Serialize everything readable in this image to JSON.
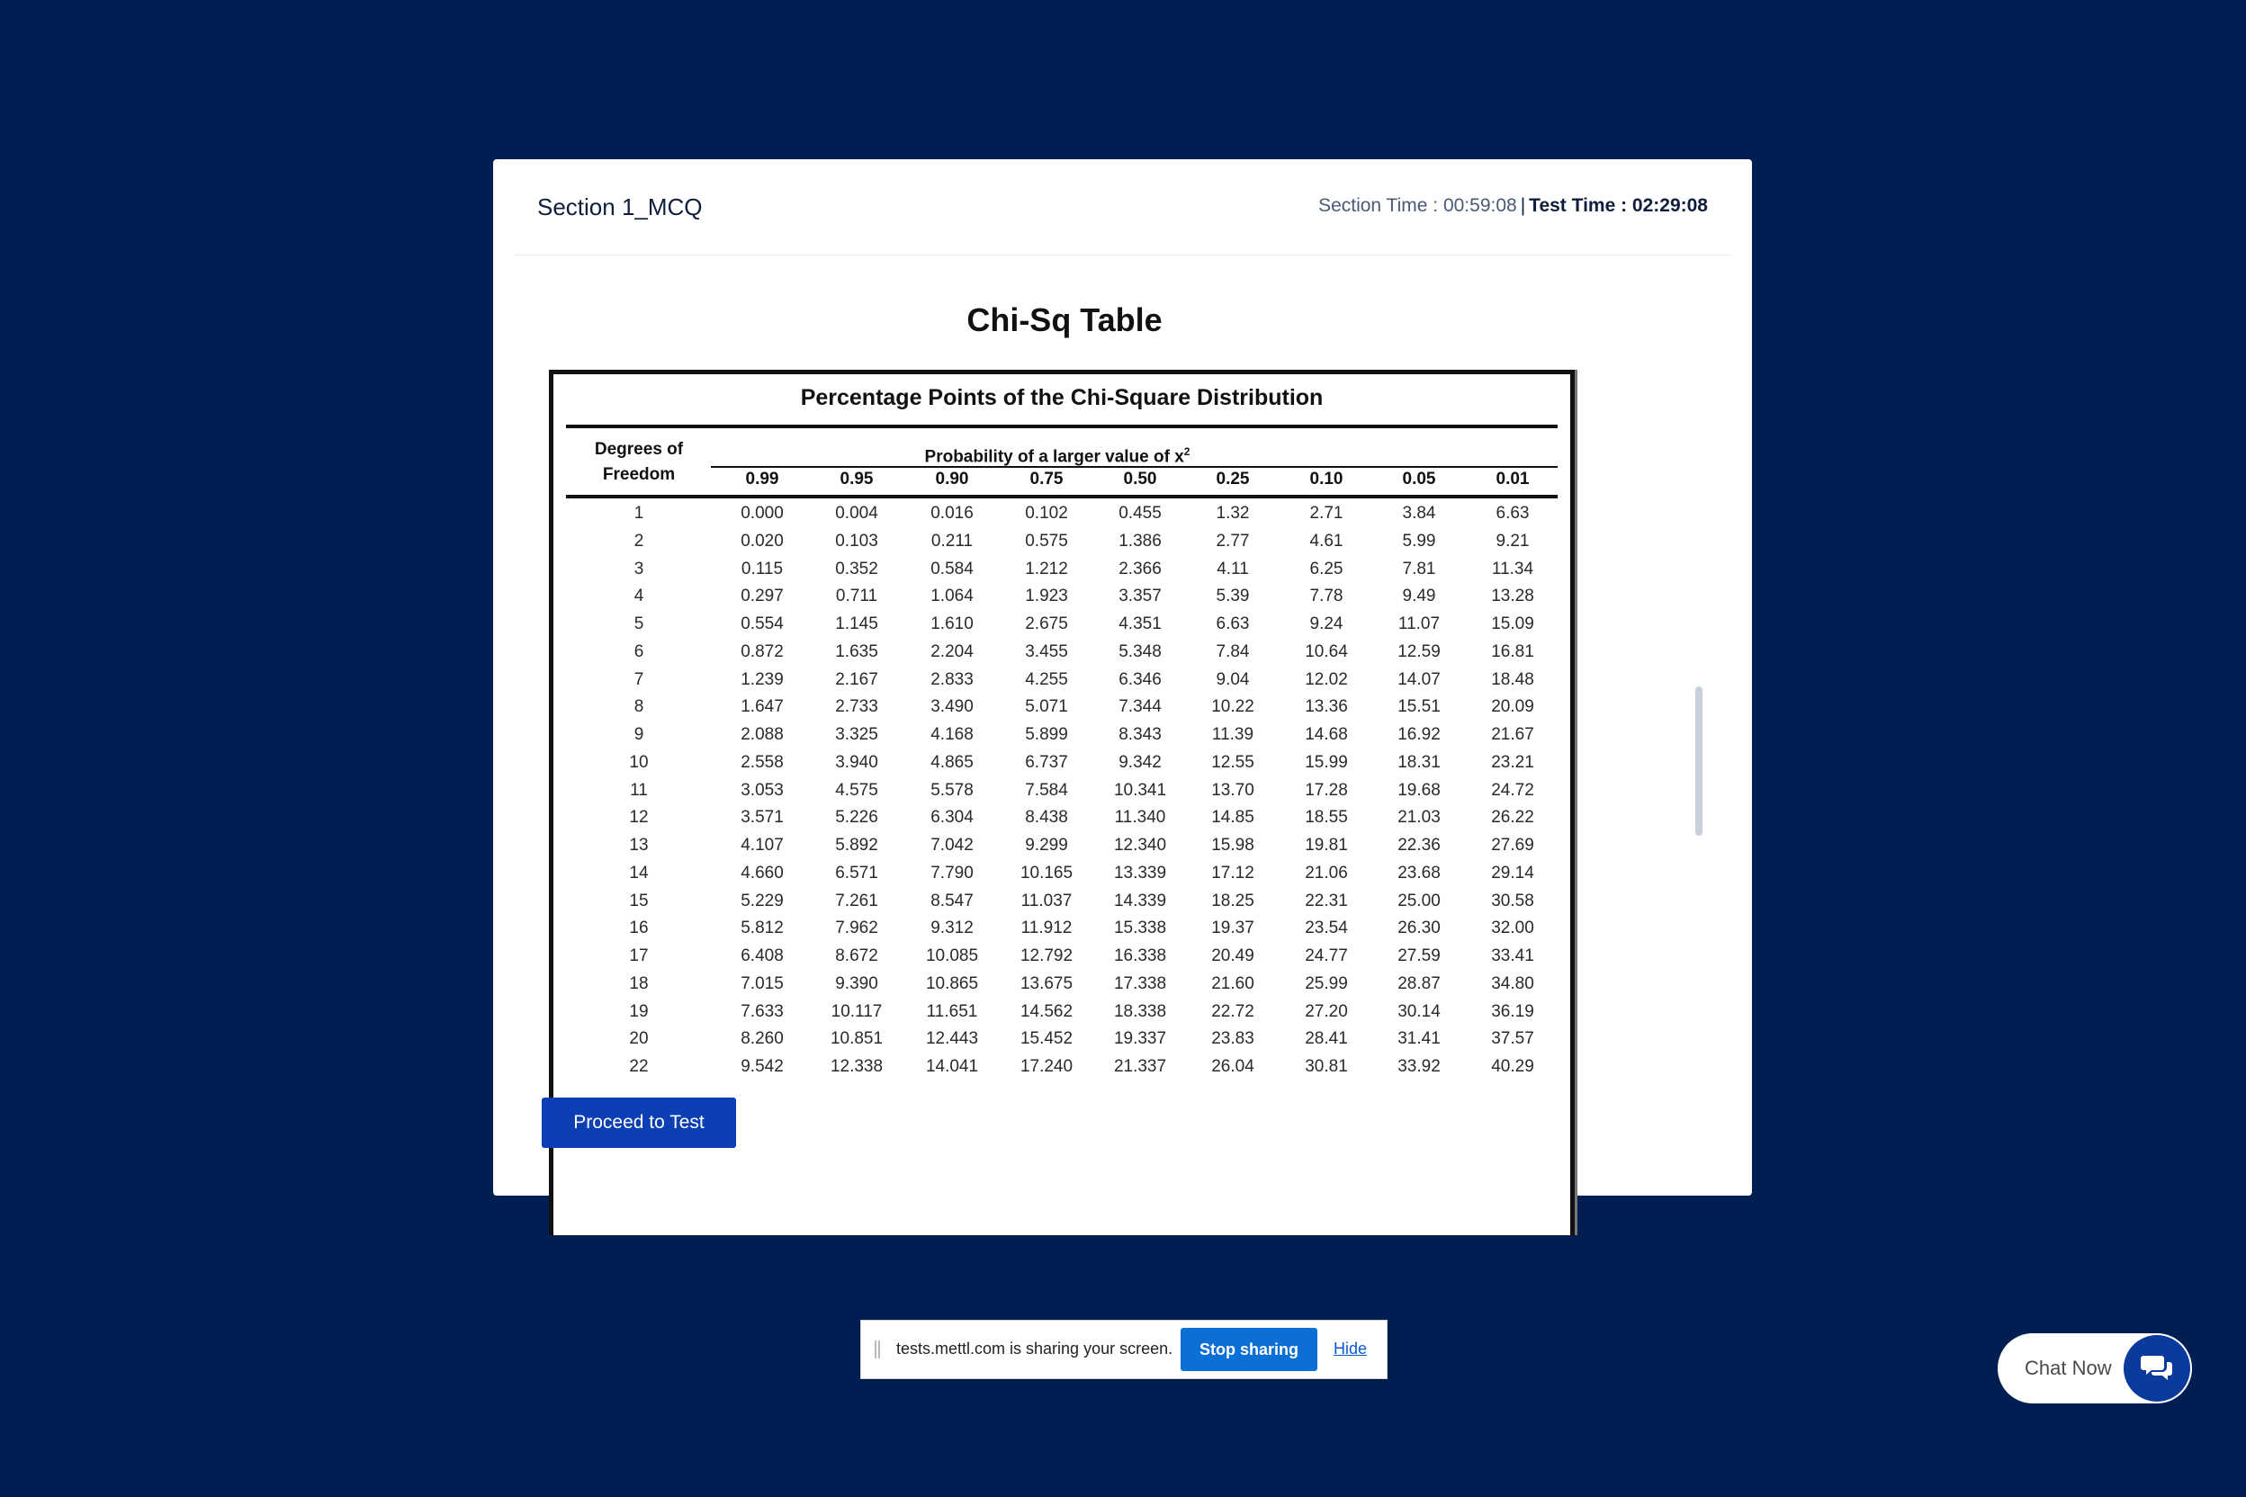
{
  "header": {
    "section_title": "Section 1_MCQ",
    "section_time_label": "Section Time : 00:59:08",
    "separator": "|",
    "test_time_label": "Test Time : 02:29:08"
  },
  "content": {
    "title": "Chi-Sq Table",
    "table": {
      "title": "Percentage Points of the Chi-Square Distribution",
      "df_header_line1": "Degrees of",
      "df_header_line2": "Freedom",
      "prob_header": "Probability of a larger value of x",
      "prob_header_sup": "2",
      "columns": [
        "0.99",
        "0.95",
        "0.90",
        "0.75",
        "0.50",
        "0.25",
        "0.10",
        "0.05",
        "0.01"
      ],
      "rows": [
        [
          "1",
          "0.000",
          "0.004",
          "0.016",
          "0.102",
          "0.455",
          "1.32",
          "2.71",
          "3.84",
          "6.63"
        ],
        [
          "2",
          "0.020",
          "0.103",
          "0.211",
          "0.575",
          "1.386",
          "2.77",
          "4.61",
          "5.99",
          "9.21"
        ],
        [
          "3",
          "0.115",
          "0.352",
          "0.584",
          "1.212",
          "2.366",
          "4.11",
          "6.25",
          "7.81",
          "11.34"
        ],
        [
          "4",
          "0.297",
          "0.711",
          "1.064",
          "1.923",
          "3.357",
          "5.39",
          "7.78",
          "9.49",
          "13.28"
        ],
        [
          "5",
          "0.554",
          "1.145",
          "1.610",
          "2.675",
          "4.351",
          "6.63",
          "9.24",
          "11.07",
          "15.09"
        ],
        [
          "6",
          "0.872",
          "1.635",
          "2.204",
          "3.455",
          "5.348",
          "7.84",
          "10.64",
          "12.59",
          "16.81"
        ],
        [
          "7",
          "1.239",
          "2.167",
          "2.833",
          "4.255",
          "6.346",
          "9.04",
          "12.02",
          "14.07",
          "18.48"
        ],
        [
          "8",
          "1.647",
          "2.733",
          "3.490",
          "5.071",
          "7.344",
          "10.22",
          "13.36",
          "15.51",
          "20.09"
        ],
        [
          "9",
          "2.088",
          "3.325",
          "4.168",
          "5.899",
          "8.343",
          "11.39",
          "14.68",
          "16.92",
          "21.67"
        ],
        [
          "10",
          "2.558",
          "3.940",
          "4.865",
          "6.737",
          "9.342",
          "12.55",
          "15.99",
          "18.31",
          "23.21"
        ],
        [
          "11",
          "3.053",
          "4.575",
          "5.578",
          "7.584",
          "10.341",
          "13.70",
          "17.28",
          "19.68",
          "24.72"
        ],
        [
          "12",
          "3.571",
          "5.226",
          "6.304",
          "8.438",
          "11.340",
          "14.85",
          "18.55",
          "21.03",
          "26.22"
        ],
        [
          "13",
          "4.107",
          "5.892",
          "7.042",
          "9.299",
          "12.340",
          "15.98",
          "19.81",
          "22.36",
          "27.69"
        ],
        [
          "14",
          "4.660",
          "6.571",
          "7.790",
          "10.165",
          "13.339",
          "17.12",
          "21.06",
          "23.68",
          "29.14"
        ],
        [
          "15",
          "5.229",
          "7.261",
          "8.547",
          "11.037",
          "14.339",
          "18.25",
          "22.31",
          "25.00",
          "30.58"
        ],
        [
          "16",
          "5.812",
          "7.962",
          "9.312",
          "11.912",
          "15.338",
          "19.37",
          "23.54",
          "26.30",
          "32.00"
        ],
        [
          "17",
          "6.408",
          "8.672",
          "10.085",
          "12.792",
          "16.338",
          "20.49",
          "24.77",
          "27.59",
          "33.41"
        ],
        [
          "18",
          "7.015",
          "9.390",
          "10.865",
          "13.675",
          "17.338",
          "21.60",
          "25.99",
          "28.87",
          "34.80"
        ],
        [
          "19",
          "7.633",
          "10.117",
          "11.651",
          "14.562",
          "18.338",
          "22.72",
          "27.20",
          "30.14",
          "36.19"
        ],
        [
          "20",
          "8.260",
          "10.851",
          "12.443",
          "15.452",
          "19.337",
          "23.83",
          "28.41",
          "31.41",
          "37.57"
        ],
        [
          "22",
          "9.542",
          "12.338",
          "14.041",
          "17.240",
          "21.337",
          "26.04",
          "30.81",
          "33.92",
          "40.29"
        ]
      ]
    }
  },
  "actions": {
    "proceed_label": "Proceed to Test"
  },
  "share_bar": {
    "message": "tests.mettl.com is sharing your screen.",
    "stop_label": "Stop sharing",
    "hide_label": "Hide"
  },
  "chat": {
    "label": "Chat Now",
    "icon": "chat-bubbles-icon"
  },
  "colors": {
    "background": "#001e51",
    "primary_button": "#0b3fb3",
    "stop_button": "#0b6fd6",
    "chat_icon_bg": "#0a3a9c"
  }
}
